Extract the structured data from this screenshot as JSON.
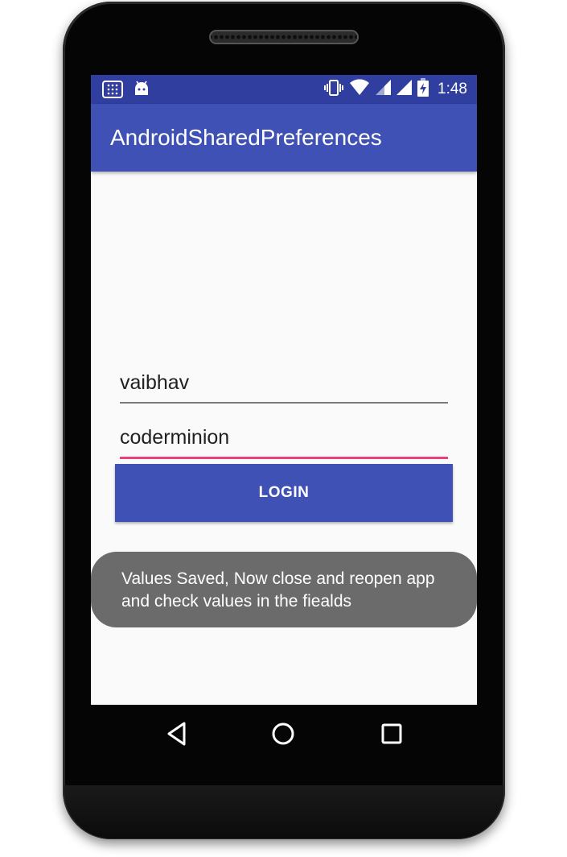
{
  "status_bar": {
    "time": "1:48",
    "left_icons": [
      "keypad-icon",
      "android-debug-icon"
    ],
    "right_icons": [
      "vibrate-icon",
      "wifi-icon",
      "cell-signal-icon",
      "cell-signal-2-icon",
      "battery-charging-icon"
    ]
  },
  "app_bar": {
    "title": "AndroidSharedPreferences"
  },
  "form": {
    "username_value": "vaibhav",
    "password_value": "coderminion",
    "login_label": "LOGIN"
  },
  "toast": {
    "message": "Values Saved, Now close and reopen app and check values in the fiealds"
  },
  "nav_bar": {
    "icons": [
      "back-icon",
      "home-icon",
      "recents-icon"
    ]
  },
  "colors": {
    "primary": "#3f51b5",
    "primary_dark": "#303f9f",
    "accent": "#ec407a",
    "toast_bg": "#6b6b6b"
  }
}
